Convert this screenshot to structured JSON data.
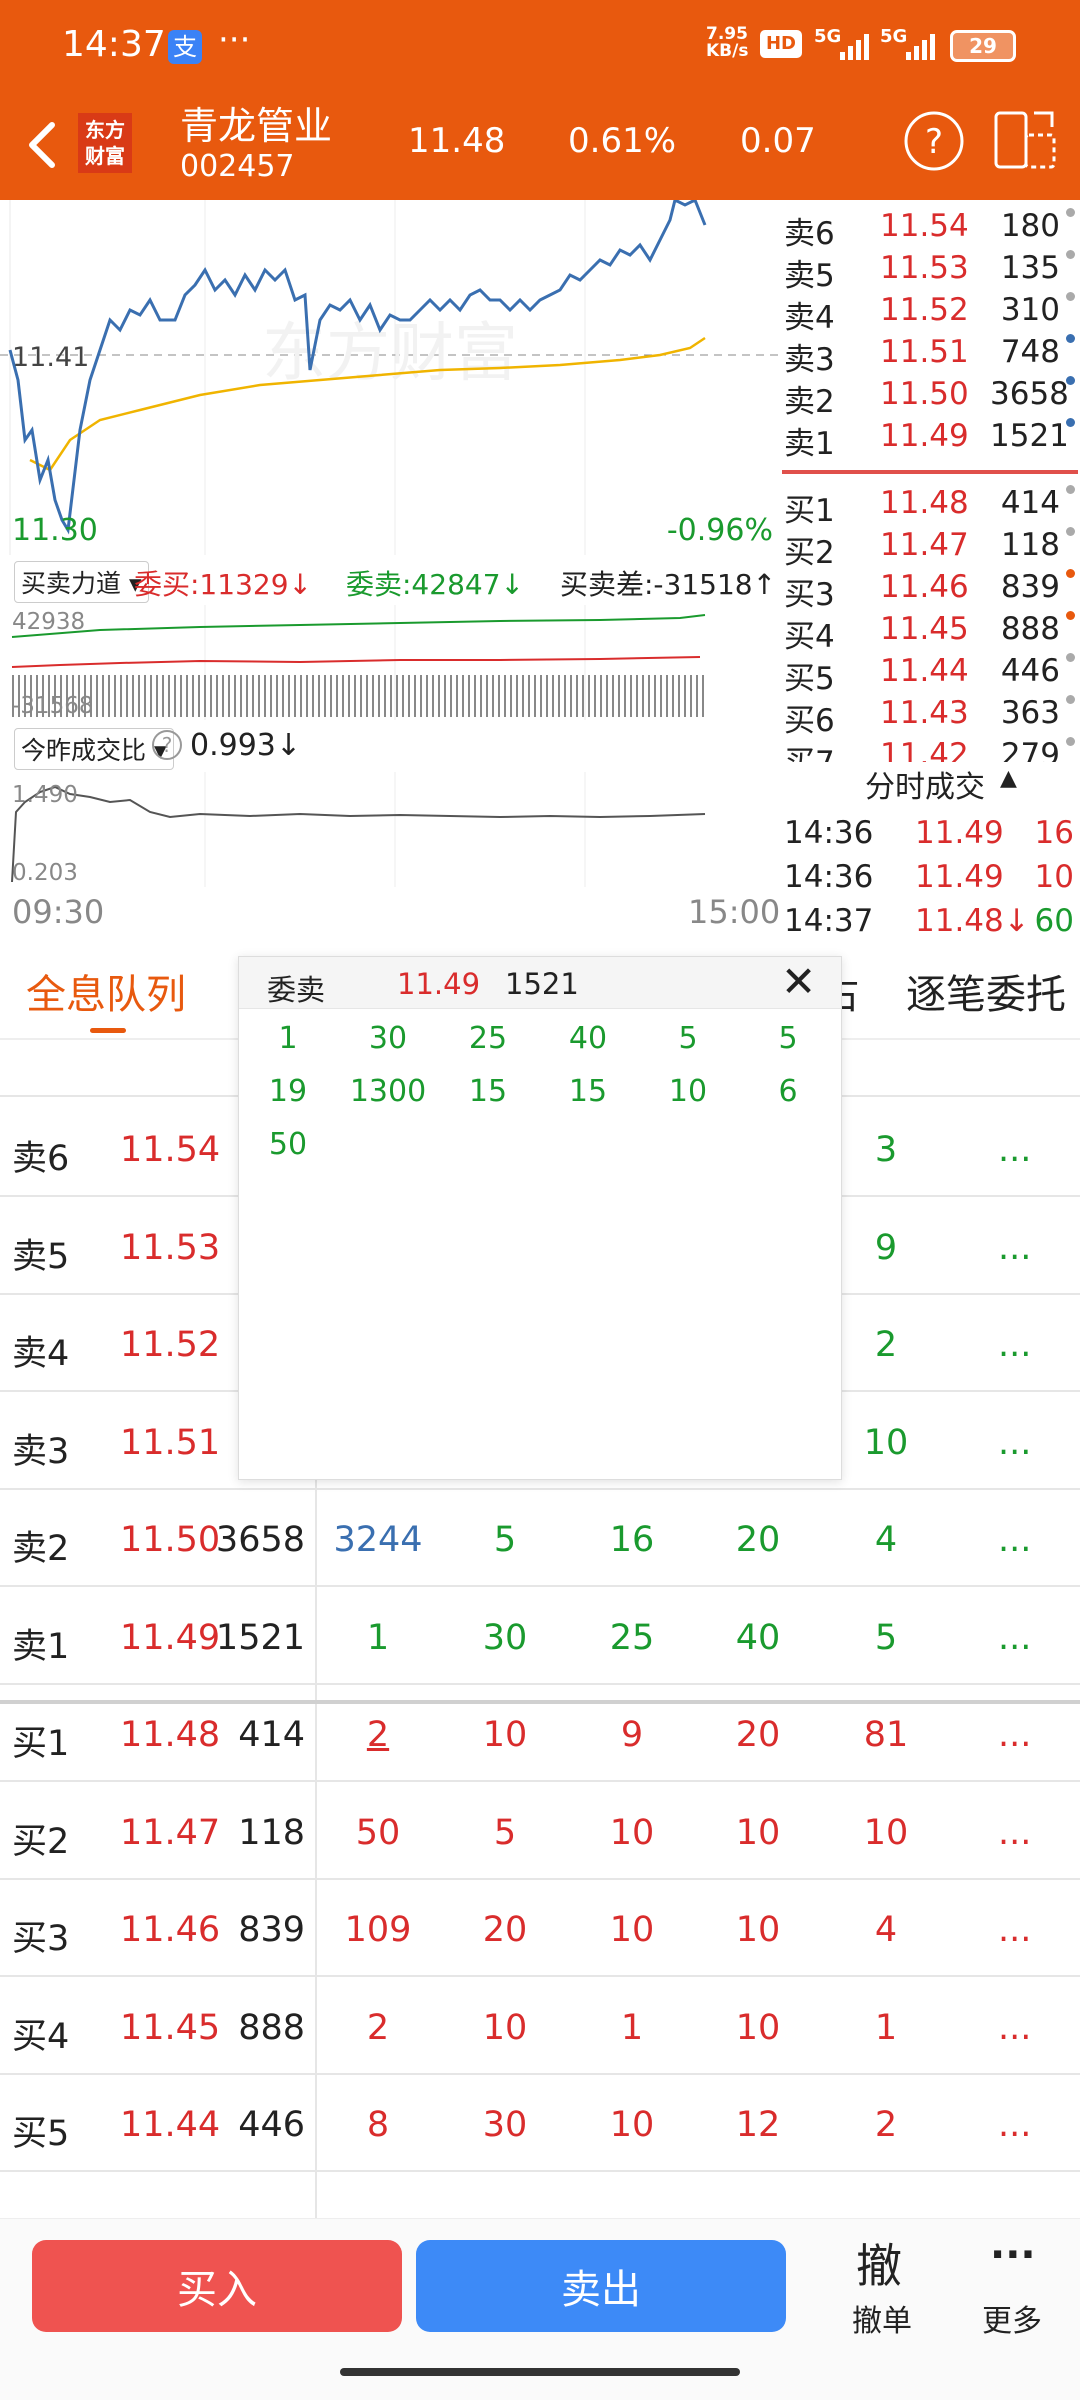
{
  "status": {
    "time": "14:37",
    "app_badge": "支",
    "dots": "···",
    "net_speed_top": "7.95",
    "net_speed_bottom": "KB/s",
    "hd": "HD",
    "sig1": "5G",
    "sig2": "5G",
    "battery": "29"
  },
  "header": {
    "logo_top": "东方",
    "logo_bottom": "财富",
    "stock_name": "青龙管业",
    "stock_code": "002457",
    "price": "11.48",
    "change_pct": "0.61%",
    "change": "0.07"
  },
  "chart": {
    "high_label": "11.41",
    "low_label": "11.30",
    "pct_label": "-0.96%",
    "watermark": "东方财富"
  },
  "power": {
    "title": "买卖力道",
    "buy": "委买:11329↓",
    "sell": "委卖:42847↓",
    "diff": "买卖差:-31518↑",
    "top": "42938",
    "bottom": "-31568"
  },
  "ratio": {
    "title": "今昨成交比",
    "value": "0.993↓",
    "top": "1.490",
    "bottom": "0.203",
    "time_start": "09:30",
    "time_end": "15:00"
  },
  "orderbook": {
    "asks": [
      {
        "label": "卖6",
        "price": "11.54",
        "vol": "180"
      },
      {
        "label": "卖5",
        "price": "11.53",
        "vol": "135"
      },
      {
        "label": "卖4",
        "price": "11.52",
        "vol": "310"
      },
      {
        "label": "卖3",
        "price": "11.51",
        "vol": "748"
      },
      {
        "label": "卖2",
        "price": "11.50",
        "vol": "3658"
      },
      {
        "label": "卖1",
        "price": "11.49",
        "vol": "1521"
      }
    ],
    "bids": [
      {
        "label": "买1",
        "price": "11.48",
        "vol": "414"
      },
      {
        "label": "买2",
        "price": "11.47",
        "vol": "118"
      },
      {
        "label": "买3",
        "price": "11.46",
        "vol": "839"
      },
      {
        "label": "买4",
        "price": "11.45",
        "vol": "888"
      },
      {
        "label": "买5",
        "price": "11.44",
        "vol": "446"
      },
      {
        "label": "买6",
        "price": "11.43",
        "vol": "363"
      },
      {
        "label": "买7",
        "price": "11.42",
        "vol": "279"
      }
    ]
  },
  "ticks": {
    "title": "分时成交",
    "rows": [
      {
        "time": "14:36",
        "price": "11.49",
        "vol": "16"
      },
      {
        "time": "14:36",
        "price": "11.49",
        "vol": "10"
      },
      {
        "time": "14:37",
        "price": "11.48↓",
        "vol": "60"
      }
    ]
  },
  "tabs": {
    "active": "全息队列",
    "partial": "占",
    "right": "逐笔委托"
  },
  "popup": {
    "label": "委卖",
    "price": "11.49",
    "vol": "1521",
    "close": "✕",
    "row1": [
      "1",
      "30",
      "25",
      "40",
      "5",
      "5"
    ],
    "row2": [
      "19",
      "1300",
      "15",
      "15",
      "10",
      "6"
    ],
    "row3": [
      "50"
    ]
  },
  "queue": {
    "rows": [
      {
        "label": "卖6",
        "price": "11.54",
        "vol": "",
        "c": [
          "",
          "",
          "",
          "",
          "3"
        ],
        "more": "..."
      },
      {
        "label": "卖5",
        "price": "11.53",
        "vol": "",
        "c": [
          "",
          "",
          "",
          "",
          "9"
        ],
        "more": "..."
      },
      {
        "label": "卖4",
        "price": "11.52",
        "vol": "",
        "c": [
          "",
          "",
          "",
          "",
          "2"
        ],
        "more": "..."
      },
      {
        "label": "卖3",
        "price": "11.51",
        "vol": "",
        "c": [
          "",
          "",
          "",
          "",
          "10"
        ],
        "more": "..."
      },
      {
        "label": "卖2",
        "price": "11.50",
        "vol": "3658",
        "c": [
          "3244",
          "5",
          "16",
          "20",
          "4"
        ],
        "more": "..."
      },
      {
        "label": "卖1",
        "price": "11.49",
        "vol": "1521",
        "c": [
          "1",
          "30",
          "25",
          "40",
          "5"
        ],
        "more": "..."
      },
      {
        "label": "买1",
        "price": "11.48",
        "vol": "414",
        "c": [
          "2",
          "10",
          "9",
          "20",
          "81"
        ],
        "more": "..."
      },
      {
        "label": "买2",
        "price": "11.47",
        "vol": "118",
        "c": [
          "50",
          "5",
          "10",
          "10",
          "10"
        ],
        "more": "..."
      },
      {
        "label": "买3",
        "price": "11.46",
        "vol": "839",
        "c": [
          "109",
          "20",
          "10",
          "10",
          "4"
        ],
        "more": "..."
      },
      {
        "label": "买4",
        "price": "11.45",
        "vol": "888",
        "c": [
          "2",
          "10",
          "1",
          "10",
          "1"
        ],
        "more": "..."
      },
      {
        "label": "买5",
        "price": "11.44",
        "vol": "446",
        "c": [
          "8",
          "30",
          "10",
          "12",
          "2"
        ],
        "more": "..."
      }
    ]
  },
  "bottom": {
    "buy": "买入",
    "sell": "卖出",
    "cancel_icon": "撤",
    "cancel": "撤单",
    "more_icon": "···",
    "more": "更多"
  },
  "colors": {
    "brand": "#e8590e",
    "up": "#d92c2c",
    "down": "#1a9a2e",
    "line": "#3a6fb0",
    "avg": "#f0b400"
  }
}
